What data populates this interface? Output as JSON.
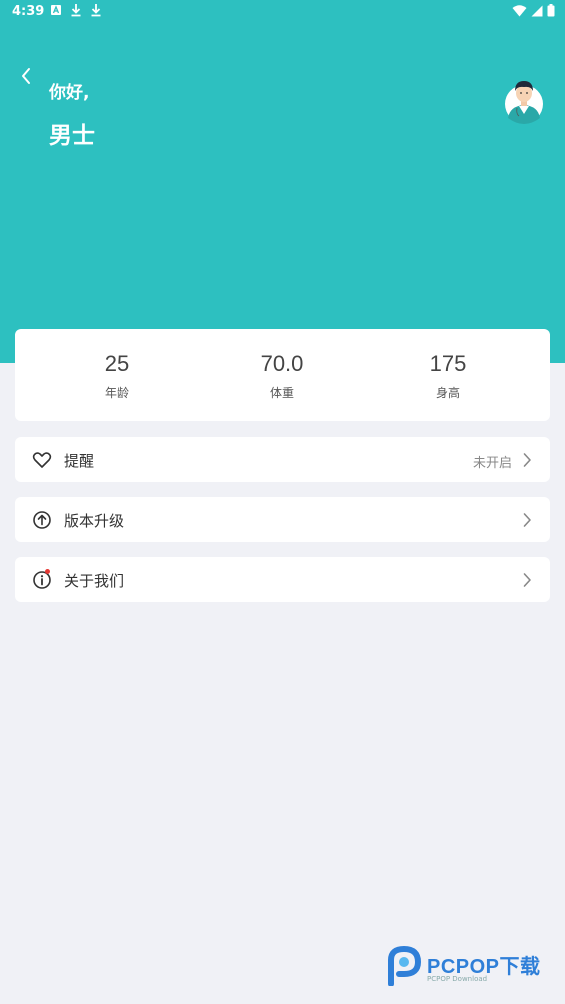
{
  "status_bar": {
    "time": "4:39"
  },
  "profile": {
    "greeting": "你好,",
    "name": "男士"
  },
  "stats": [
    {
      "value": "25",
      "label": "年龄"
    },
    {
      "value": "70.0",
      "label": "体重"
    },
    {
      "value": "175",
      "label": "身高"
    }
  ],
  "menu": [
    {
      "label": "提醒",
      "status": "未开启",
      "icon": "heart-icon"
    },
    {
      "label": "版本升级",
      "icon": "upgrade-icon"
    },
    {
      "label": "关于我们",
      "icon": "info-icon"
    }
  ],
  "watermark": {
    "brand": "PCPOP下载",
    "sub": "PCPOP Download"
  },
  "colors": {
    "header": "#2dc0c0",
    "background": "#f0f1f6",
    "badge": "#e53935"
  }
}
